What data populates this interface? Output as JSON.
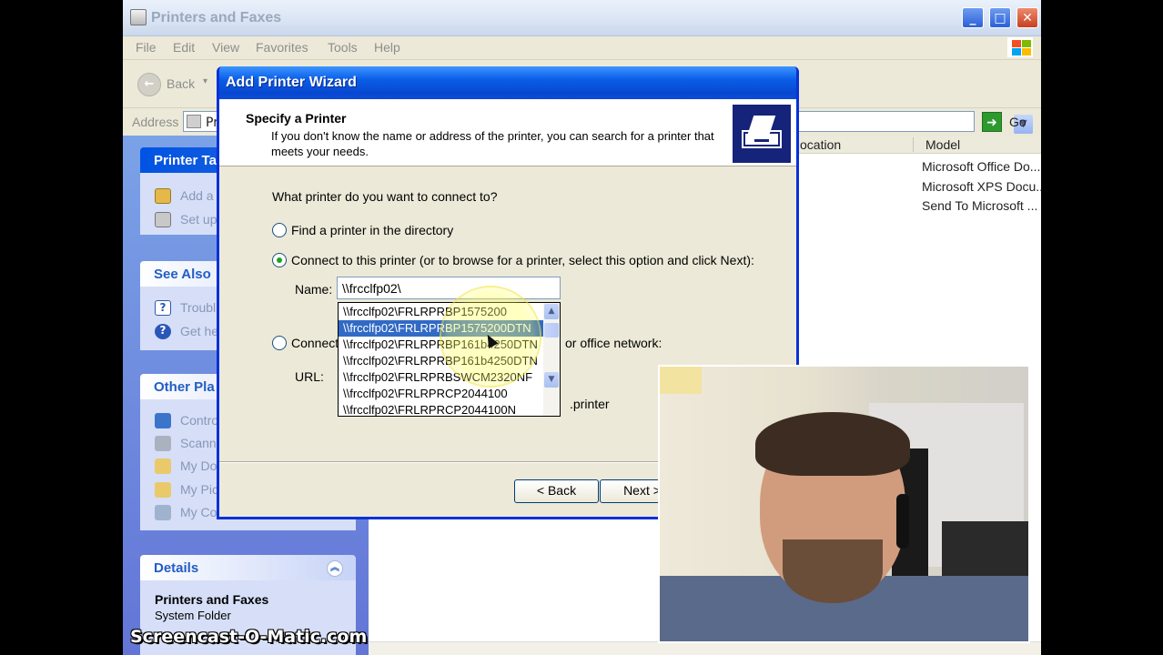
{
  "window": {
    "title": "Printers and Faxes"
  },
  "menu": [
    "File",
    "Edit",
    "View",
    "Favorites",
    "Tools",
    "Help"
  ],
  "toolbar": {
    "back_label": "Back"
  },
  "address": {
    "label": "Address",
    "value": "Pr",
    "go_label": "Go"
  },
  "taskpane": {
    "printer_tasks": {
      "title": "Printer Ta",
      "items": [
        "Add a",
        "Set up"
      ]
    },
    "see_also": {
      "title": "See Also",
      "items": [
        "Troubl",
        "Get he"
      ]
    },
    "other_places": {
      "title": "Other Pla",
      "items": [
        "Contro",
        "Scann",
        "My Do",
        "My Pic",
        "My Co"
      ]
    },
    "details": {
      "title": "Details",
      "name": "Printers and Faxes",
      "type": "System Folder"
    }
  },
  "list": {
    "columns": [
      "ocation",
      "Model"
    ],
    "models": [
      "Microsoft Office Do...",
      "Microsoft XPS Docu...",
      "Send To Microsoft ..."
    ]
  },
  "wizard": {
    "title": "Add Printer Wizard",
    "heading": "Specify a Printer",
    "subtitle": "If you don't know the name or address of the printer, you can search for a printer that meets your needs.",
    "question": "What printer do you want to connect to?",
    "option_find": "Find a printer in the directory",
    "option_connect": "Connect to this printer (or to browse for a printer, select this option and click Next):",
    "name_label": "Name:",
    "name_value": "\\\\frcclfp02\\",
    "option_internet_left": "Connect",
    "option_internet_right": "or office network:",
    "url_label": "URL:",
    "url_hint": ".printer",
    "suggestions": [
      "\\\\frcclfp02\\FRLRPRBP1575200",
      "\\\\frcclfp02\\FRLRPRBP1575200DTN",
      "\\\\frcclfp02\\FRLRPRBP161b4250DTN",
      "\\\\frcclfp02\\FRLRPRBP161b4250DTN",
      "\\\\frcclfp02\\FRLRPRBSWCM2320NF",
      "\\\\frcclfp02\\FRLRPRCP2044100",
      "\\\\frcclfp02\\FRLRPRCP2044100N"
    ],
    "selected_index": 1,
    "back_button": "< Back",
    "next_button": "Next >"
  },
  "watermark": "Screencast-O-Matic.com",
  "colors": {
    "xp_blue": "#0a5ee8",
    "selection": "#316ac5",
    "taskpane": "#7ba2e7"
  }
}
